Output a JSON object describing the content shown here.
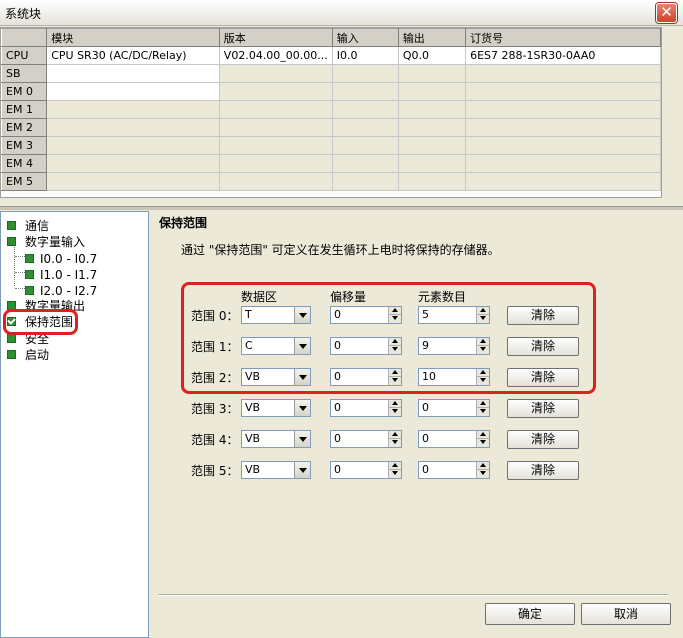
{
  "window": {
    "title": "系统块",
    "close_glyph": "✕"
  },
  "grid": {
    "headers": [
      "",
      "模块",
      "版本",
      "输入",
      "输出",
      "订货号"
    ],
    "rows": [
      {
        "label": "CPU",
        "module": "CPU SR30 (AC/DC/Relay)",
        "version": "V02.04.00_00.00...",
        "input": "I0.0",
        "output": "Q0.0",
        "order": "6ES7 288-1SR30-0AA0"
      },
      {
        "label": "SB",
        "module": "",
        "version": "",
        "input": "",
        "output": "",
        "order": ""
      },
      {
        "label": "EM 0",
        "module": "",
        "version": "",
        "input": "",
        "output": "",
        "order": ""
      },
      {
        "label": "EM 1",
        "module": "",
        "version": "",
        "input": "",
        "output": "",
        "order": ""
      },
      {
        "label": "EM 2",
        "module": "",
        "version": "",
        "input": "",
        "output": "",
        "order": ""
      },
      {
        "label": "EM 3",
        "module": "",
        "version": "",
        "input": "",
        "output": "",
        "order": ""
      },
      {
        "label": "EM 4",
        "module": "",
        "version": "",
        "input": "",
        "output": "",
        "order": ""
      },
      {
        "label": "EM 5",
        "module": "",
        "version": "",
        "input": "",
        "output": "",
        "order": ""
      }
    ]
  },
  "tree": {
    "items": [
      {
        "label": "通信",
        "level": 0,
        "checked": false
      },
      {
        "label": "数字量输入",
        "level": 0,
        "checked": false
      },
      {
        "label": "I0.0 - I0.7",
        "level": 1,
        "checked": false
      },
      {
        "label": "I1.0 - I1.7",
        "level": 1,
        "checked": false
      },
      {
        "label": "I2.0 - I2.7",
        "level": 1,
        "checked": false
      },
      {
        "label": "数字量输出",
        "level": 0,
        "checked": false
      },
      {
        "label": "保持范围",
        "level": 0,
        "checked": true,
        "selected": true
      },
      {
        "label": "安全",
        "level": 0,
        "checked": false
      },
      {
        "label": "启动",
        "level": 0,
        "checked": false
      }
    ]
  },
  "panel": {
    "heading": "保持范围",
    "description": "通过 \"保持范围\" 可定义在发生循环上电时将保持的存储器。",
    "col_area": "数据区",
    "col_offset": "偏移量",
    "col_count": "元素数目",
    "ranges": [
      {
        "label": "范围 0：",
        "area": "T",
        "offset": "0",
        "count": "5",
        "clear": "清除"
      },
      {
        "label": "范围 1：",
        "area": "C",
        "offset": "0",
        "count": "9",
        "clear": "清除"
      },
      {
        "label": "范围 2：",
        "area": "VB",
        "offset": "0",
        "count": "10",
        "clear": "清除"
      },
      {
        "label": "范围 3：",
        "area": "VB",
        "offset": "0",
        "count": "0",
        "clear": "清除"
      },
      {
        "label": "范围 4：",
        "area": "VB",
        "offset": "0",
        "count": "0",
        "clear": "清除"
      },
      {
        "label": "范围 5：",
        "area": "VB",
        "offset": "0",
        "count": "0",
        "clear": "清除"
      }
    ]
  },
  "footer": {
    "ok": "确定",
    "cancel": "取消"
  },
  "colors": {
    "highlight": "#e0201e",
    "checkbox": "#2d8f2d"
  }
}
